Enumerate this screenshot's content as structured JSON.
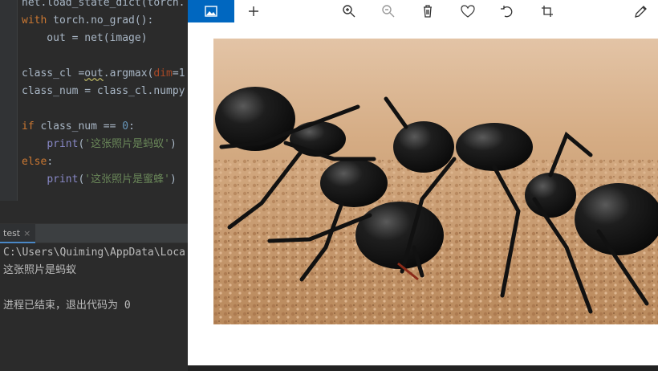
{
  "editor": {
    "lines": [
      {
        "parts": [
          {
            "t": "net.load_state_dict(torch.",
            "c": "plain"
          }
        ]
      },
      {
        "parts": [
          {
            "t": "with ",
            "c": "kw"
          },
          {
            "t": "torch.no_grad():",
            "c": "plain"
          }
        ]
      },
      {
        "parts": [
          {
            "t": "    out = net(image)",
            "c": "plain"
          }
        ]
      },
      {
        "parts": [
          {
            "t": "",
            "c": "plain"
          }
        ]
      },
      {
        "parts": [
          {
            "t": "class_cl =",
            "c": "plain"
          },
          {
            "t": "out",
            "c": "warn"
          },
          {
            "t": ".argmax(",
            "c": "plain"
          },
          {
            "t": "dim",
            "c": "param"
          },
          {
            "t": "=1",
            "c": "plain"
          }
        ]
      },
      {
        "parts": [
          {
            "t": "class_num = class_cl.numpy",
            "c": "plain"
          }
        ]
      },
      {
        "parts": [
          {
            "t": "",
            "c": "plain"
          }
        ]
      },
      {
        "parts": [
          {
            "t": "if ",
            "c": "kw"
          },
          {
            "t": "class_num == ",
            "c": "plain"
          },
          {
            "t": "0",
            "c": "num"
          },
          {
            "t": ":",
            "c": "plain"
          }
        ]
      },
      {
        "parts": [
          {
            "t": "    ",
            "c": "plain"
          },
          {
            "t": "print",
            "c": "fn"
          },
          {
            "t": "(",
            "c": "plain"
          },
          {
            "t": "'这张照片是蚂蚁'",
            "c": "str"
          },
          {
            "t": ")",
            "c": "plain"
          }
        ]
      },
      {
        "parts": [
          {
            "t": "else",
            "c": "kw"
          },
          {
            "t": ":",
            "c": "plain"
          }
        ]
      },
      {
        "parts": [
          {
            "t": "    ",
            "c": "plain"
          },
          {
            "t": "print",
            "c": "fn"
          },
          {
            "t": "(",
            "c": "plain"
          },
          {
            "t": "'这张照片是蜜蜂'",
            "c": "str"
          },
          {
            "t": ")",
            "c": "plain"
          }
        ]
      }
    ]
  },
  "run": {
    "tab_label": "test",
    "tab_close": "×",
    "output": [
      "C:\\Users\\Quiming\\AppData\\Loca",
      "这张照片是蚂蚁",
      "",
      "进程已结束，退出代码为 0"
    ]
  },
  "viewer": {
    "toolbar_icons": [
      "photo-icon",
      "add-icon",
      "zoom-in-icon",
      "zoom-out-icon",
      "delete-icon",
      "favorite-icon",
      "rotate-icon",
      "crop-icon",
      "edit-icon"
    ],
    "image_alt": "ants"
  },
  "colors": {
    "ide_bg": "#2b2b2b",
    "keyword": "#cc7832",
    "string": "#6a8759",
    "accent": "#0067c0"
  }
}
